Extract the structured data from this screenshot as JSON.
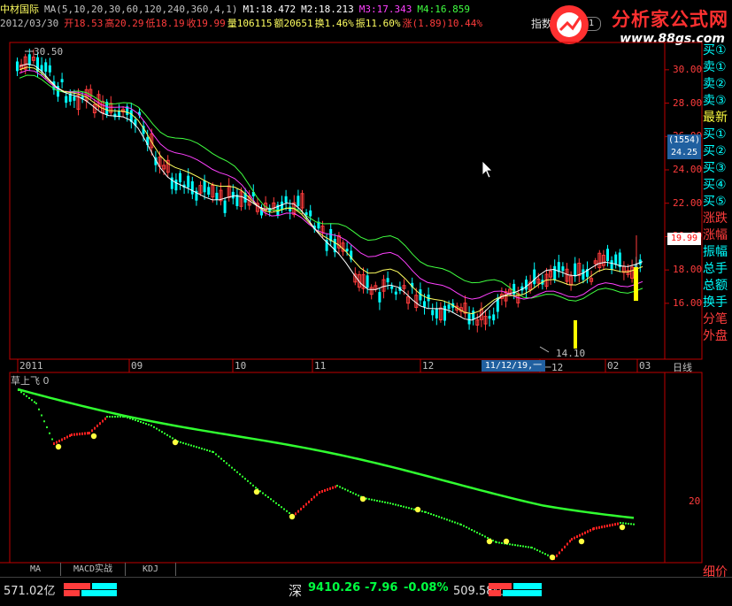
{
  "header": {
    "stock_name": "中材国际",
    "ma_params": "MA(5,10,20,30,60,120,240,360,4,1)",
    "m1": "M1:18.472",
    "m2": "M2:18.213",
    "m3": "M3:17.343",
    "m4": "M4:16.859",
    "date": "2012/03/30",
    "open": "开18.53",
    "high": "高20.29",
    "low": "低18.19",
    "close": "收19.99",
    "volume": "量106115",
    "amount": "额20651",
    "turnover": "换1.46%",
    "amplitude": "振11.60%",
    "change": "涨(1.89)10.44%",
    "index_label": "指数",
    "index_box": "19.91"
  },
  "logo": {
    "brand": "分析家公式网",
    "site": "www.88gs.com"
  },
  "colors": {
    "up": "#ff3c3c",
    "down": "#00ffff",
    "ma_white": "#ffffff",
    "ma_yellow": "#ffff60",
    "ma_magenta": "#ff40ff",
    "ma_green": "#40ff40",
    "axis": "#c00000",
    "indicator_green": "#30ff30"
  },
  "main_chart": {
    "y_ticks": [
      "30.00",
      "28.00",
      "26.00",
      "24.00",
      "22.00",
      "20.00",
      "18.00",
      "16.00"
    ],
    "price_badge": "(1554)",
    "price_badge2": "24.25",
    "last_price_label": "19.99",
    "high_annotation": "30.50",
    "low_annotation": "14.10",
    "x_labels": [
      "2011",
      "09",
      "10",
      "11",
      "12",
      "一12",
      "02",
      "03"
    ],
    "cursor_date": "11/12/19,一",
    "period": "日线"
  },
  "chart_data": {
    "type": "line",
    "title": "",
    "ylim": [
      13.5,
      31
    ],
    "x": [
      "2011",
      "09",
      "10",
      "11",
      "12",
      "01",
      "02",
      "03"
    ],
    "series": [
      {
        "name": "M1",
        "values": [
          30.2,
          27.5,
          22.5,
          21.8,
          17.0,
          15.2,
          17.8,
          18.5
        ]
      },
      {
        "name": "M2",
        "values": [
          30.0,
          27.8,
          23.5,
          21.5,
          18.0,
          15.6,
          17.2,
          18.2
        ]
      },
      {
        "name": "M3",
        "values": [
          29.8,
          28.0,
          24.5,
          21.2,
          19.0,
          16.5,
          16.5,
          17.3
        ]
      },
      {
        "name": "M4",
        "values": [
          29.5,
          28.2,
          25.5,
          21.5,
          20.0,
          17.5,
          16.3,
          16.9
        ]
      }
    ]
  },
  "indicator": {
    "title": "草上飞 0",
    "y_tick": "20",
    "tabs": [
      "MA",
      "MACD实战",
      "KDJ"
    ]
  },
  "side_panel": [
    "买①",
    "卖①",
    "卖②",
    "卖③",
    "最新",
    "买①",
    "买②",
    "买③",
    "买④",
    "买⑤",
    "涨跌",
    "涨幅",
    "振幅",
    "总手",
    "总额",
    "换手",
    "分笔",
    "外盘"
  ],
  "side_corner": "细价",
  "status": {
    "left": "571.02亿",
    "market": "深",
    "index": "9410.26",
    "change": "-7.96",
    "pct": "-0.08%",
    "amount": "509.58亿"
  }
}
